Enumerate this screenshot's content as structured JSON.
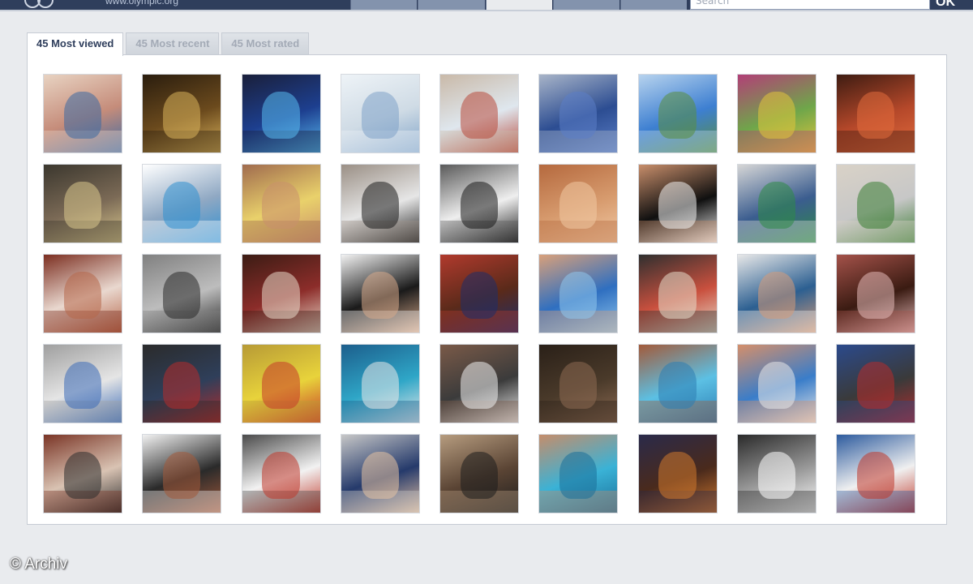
{
  "header": {
    "url": "www.olympic.org",
    "search_placeholder": "Search",
    "ok_label": "OK"
  },
  "tabs": [
    {
      "label": "45 Most viewed",
      "active": true
    },
    {
      "label": "45 Most recent",
      "active": false
    },
    {
      "label": "45 Most rated",
      "active": false
    }
  ],
  "gallery": {
    "thumbnails": [
      {
        "c1": "#c58c7a",
        "c2": "#3d6aa3",
        "c3": "#e8d3c2"
      },
      {
        "c1": "#6b4a1d",
        "c2": "#d9b25b",
        "c3": "#2a1d0e"
      },
      {
        "c1": "#1d3f8f",
        "c2": "#58b9ef",
        "c3": "#1a1f3a"
      },
      {
        "c1": "#cfdbe5",
        "c2": "#7fa3c8",
        "c3": "#eef3f7"
      },
      {
        "c1": "#dfe7ee",
        "c2": "#b84a3c",
        "c3": "#c9b9a8"
      },
      {
        "c1": "#2c4d92",
        "c2": "#5b7ec6",
        "c3": "#a8b4c8"
      },
      {
        "c1": "#3d7fd1",
        "c2": "#5a8e3e",
        "c3": "#b7d3ee"
      },
      {
        "c1": "#6fa64a",
        "c2": "#e1c53c",
        "c3": "#b23f77"
      },
      {
        "c1": "#b5482a",
        "c2": "#e16b3d",
        "c3": "#3e1c12"
      },
      {
        "c1": "#7b6a56",
        "c2": "#d9c78d",
        "c3": "#3b372e"
      },
      {
        "c1": "#8fa8c3",
        "c2": "#2f8fd0",
        "c3": "#ffffff"
      },
      {
        "c1": "#e9d16b",
        "c2": "#c98f6b",
        "c3": "#a06b4e"
      },
      {
        "c1": "#e6e6e6",
        "c2": "#1e1e1e",
        "c3": "#9a8f85"
      },
      {
        "c1": "#efefef",
        "c2": "#1a1a1a",
        "c3": "#5a5a5a"
      },
      {
        "c1": "#d79b6e",
        "c2": "#f1c8a3",
        "c3": "#b5693e"
      },
      {
        "c1": "#101010",
        "c2": "#f3f3f3",
        "c3": "#c88e6b"
      },
      {
        "c1": "#3b5d8f",
        "c2": "#2e8a46",
        "c3": "#d6d6d6"
      },
      {
        "c1": "#c7c7c7",
        "c2": "#3b7d33",
        "c3": "#d9d2c7"
      },
      {
        "c1": "#e9d8cf",
        "c2": "#b7674b",
        "c3": "#7c2f21"
      },
      {
        "c1": "#bdbdbd",
        "c2": "#2a2a2a",
        "c3": "#808080"
      },
      {
        "c1": "#8c2d2a",
        "c2": "#e8d8c9",
        "c3": "#3b1c14"
      },
      {
        "c1": "#1a1a1a",
        "c2": "#d7a98a",
        "c3": "#f2f2f2"
      },
      {
        "c1": "#5a2a1a",
        "c2": "#1e2e6a",
        "c3": "#b13a2d"
      },
      {
        "c1": "#2f6fc0",
        "c2": "#8fc6ec",
        "c3": "#d9a07a"
      },
      {
        "c1": "#c9503e",
        "c2": "#e6dccb",
        "c3": "#2f2f2f"
      },
      {
        "c1": "#2c5f91",
        "c2": "#d69b78",
        "c3": "#e8e8e8"
      },
      {
        "c1": "#3a1b12",
        "c2": "#e4b9b8",
        "c3": "#a4524a"
      },
      {
        "c1": "#e5e5e5",
        "c2": "#3c6cb8",
        "c3": "#9f9f9f"
      },
      {
        "c1": "#2f3f5a",
        "c2": "#b52b2b",
        "c3": "#2b2b2b"
      },
      {
        "c1": "#e8d33b",
        "c2": "#c73b2a",
        "c3": "#b79a36"
      },
      {
        "c1": "#2fa6c7",
        "c2": "#e8e8e8",
        "c3": "#1c5e8c"
      },
      {
        "c1": "#3b3b3b",
        "c2": "#f0f0f0",
        "c3": "#7a5a48"
      },
      {
        "c1": "#4a3a2a",
        "c2": "#8c6a52",
        "c3": "#2a2018"
      },
      {
        "c1": "#5cc0e4",
        "c2": "#2d7eb3",
        "c3": "#a35a3a"
      },
      {
        "c1": "#3a7dc9",
        "c2": "#e7e7e7",
        "c3": "#d58f6a"
      },
      {
        "c1": "#3a3a3a",
        "c2": "#b52c2c",
        "c3": "#2b4a8c"
      },
      {
        "c1": "#d9c3b3",
        "c2": "#2e2e2e",
        "c3": "#7a3526"
      },
      {
        "c1": "#2a2a2a",
        "c2": "#a3593b",
        "c3": "#f1f1f1"
      },
      {
        "c1": "#f2f2f2",
        "c2": "#c0392b",
        "c3": "#4a4a4a"
      },
      {
        "c1": "#253a6b",
        "c2": "#e5c2a3",
        "c3": "#c7c7c7"
      },
      {
        "c1": "#5a4434",
        "c2": "#1e1e1e",
        "c3": "#b69c7f"
      },
      {
        "c1": "#3ab2d6",
        "c2": "#1b6f99",
        "c3": "#c58d6b"
      },
      {
        "c1": "#4a2a1c",
        "c2": "#d0782e",
        "c3": "#2a2a4a"
      },
      {
        "c1": "#9a9a9a",
        "c2": "#ffffff",
        "c3": "#2a2a2a"
      },
      {
        "c1": "#f0f0f0",
        "c2": "#c0392b",
        "c3": "#2d5b9e"
      }
    ]
  },
  "caption": "© Archiv"
}
